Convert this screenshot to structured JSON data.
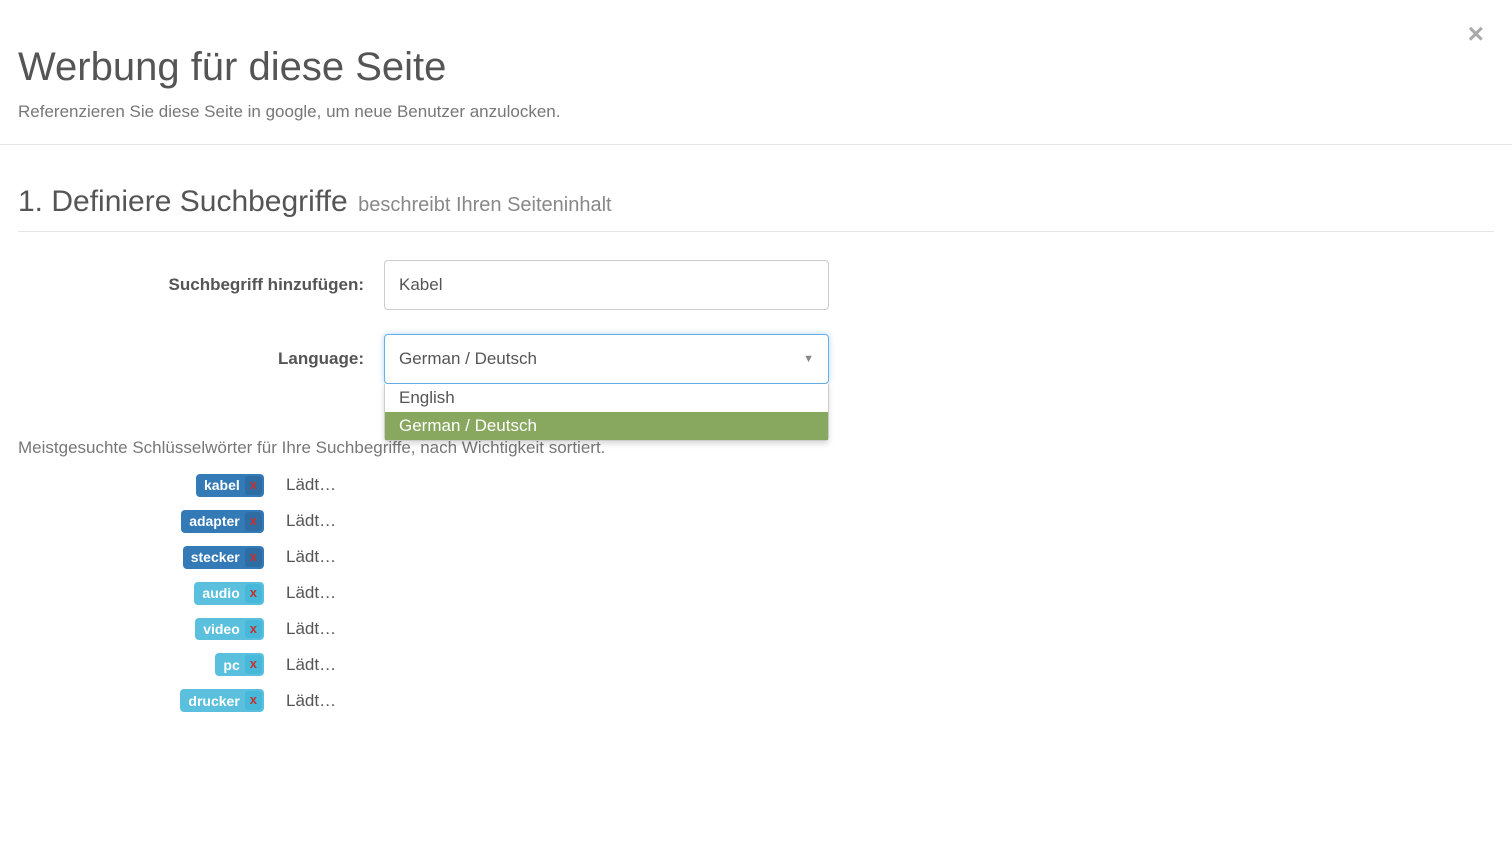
{
  "modal": {
    "close_label": "×",
    "title": "Werbung für diese Seite",
    "subtitle": "Referenzieren Sie diese Seite in google, um neue Benutzer anzulocken."
  },
  "section": {
    "title": "1. Definiere Suchbegriffe",
    "subtitle": "beschreibt Ihren Seiteninhalt"
  },
  "form": {
    "search_term_label": "Suchbegriff hinzufügen:",
    "search_term_value": "Kabel",
    "language_label": "Language:",
    "language_selected": "German / Deutsch",
    "language_options": [
      {
        "label": "English",
        "selected": false
      },
      {
        "label": "German / Deutsch",
        "selected": true
      }
    ]
  },
  "keywords": {
    "description": "Meistgesuchte Schlüsselwörter für Ihre Suchbegriffe, nach Wichtigkeit sortiert.",
    "remove_label": "x",
    "items": [
      {
        "label": "kabel",
        "style": "dark",
        "status": "Lädt…"
      },
      {
        "label": "adapter",
        "style": "dark",
        "status": "Lädt…"
      },
      {
        "label": "stecker",
        "style": "dark",
        "status": "Lädt…"
      },
      {
        "label": "audio",
        "style": "light",
        "status": "Lädt…"
      },
      {
        "label": "video",
        "style": "light",
        "status": "Lädt…"
      },
      {
        "label": "pc",
        "style": "light",
        "status": "Lädt…"
      },
      {
        "label": "drucker",
        "style": "light",
        "status": "Lädt…"
      }
    ]
  }
}
